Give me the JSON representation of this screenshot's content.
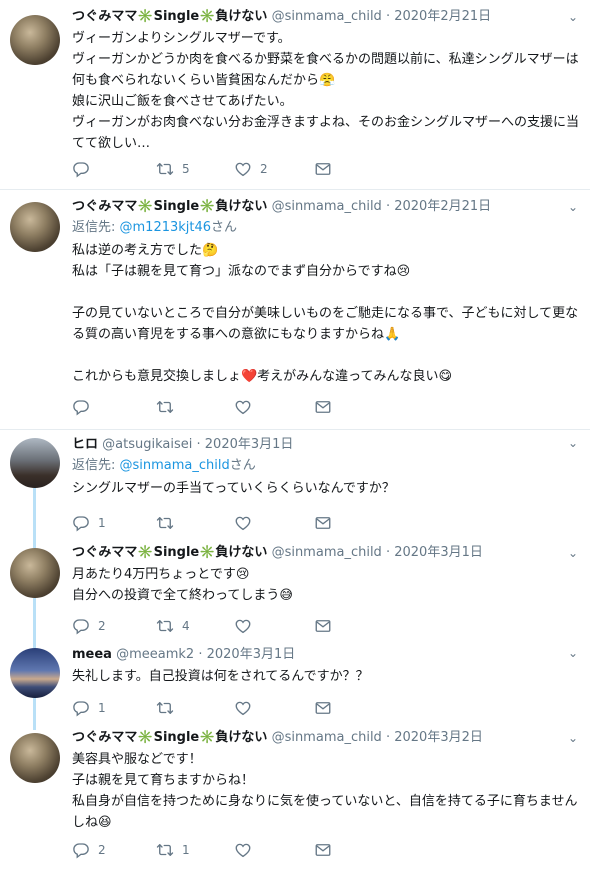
{
  "tweets": [
    {
      "name": "つぐみママ✳️Single✳️負けない",
      "handle": "@sinmama_child",
      "dot": "·",
      "date": "2020年2月21日",
      "text": "ヴィーガンよりシングルマザーです。\nヴィーガンかどうか肉を食べるか野菜を食べるかの問題以前に、私達シングルマザーは何も食べられないくらい皆貧困なんだから😤\n娘に沢山ご飯を食べさせてあげたい。\nヴィーガンがお肉食べない分お金浮きますよね、そのお金シングルマザーへの支援に当てて欲しい…",
      "reply_count": "",
      "retweet_count": "5",
      "like_count": "2"
    },
    {
      "name": "つぐみママ✳️Single✳️負けない",
      "handle": "@sinmama_child",
      "dot": "·",
      "date": "2020年2月21日",
      "reply_prefix": "返信先: ",
      "reply_link": "@m1213kjt46",
      "reply_suffix": "さん",
      "text": "私は逆の考え方でした🤔\n私は「子は親を見て育つ」派なのでまず自分からですね😢\n\n子の見ていないところで自分が美味しいものをご馳走になる事で、子どもに対して更なる質の高い育児をする事への意欲にもなりますからね🙏\n\nこれからも意見交換しましょ❤️考えがみんな違ってみんな良い😋",
      "reply_count": "",
      "retweet_count": "",
      "like_count": ""
    },
    {
      "name": "ヒロ",
      "handle": "@atsugikaisei",
      "dot": "·",
      "date": "2020年3月1日",
      "reply_prefix": "返信先: ",
      "reply_link": "@sinmama_child",
      "reply_suffix": "さん",
      "text": "シングルマザーの手当てっていくらくらいなんですか？",
      "reply_count": "1",
      "retweet_count": "",
      "like_count": ""
    },
    {
      "name": "つぐみママ✳️Single✳️負けない",
      "handle": "@sinmama_child",
      "dot": "·",
      "date": "2020年3月1日",
      "text": "月あたり4万円ちょっとです😢\n自分への投資で全て終わってしまう😅",
      "reply_count": "2",
      "retweet_count": "4",
      "like_count": ""
    },
    {
      "name": "meea",
      "handle": "@meeamk2",
      "dot": "·",
      "date": "2020年3月1日",
      "text": "失礼します。自己投資は何をされてるんですか？？",
      "reply_count": "1",
      "retweet_count": "",
      "like_count": ""
    },
    {
      "name": "つぐみママ✳️Single✳️負けない",
      "handle": "@sinmama_child",
      "dot": "·",
      "date": "2020年3月2日",
      "text": "美容具や服などです！\n子は親を見て育ちますからね！\n私自身が自信を持つために身なりに気を使っていないと、自信を持てる子に育ちませんしね😆",
      "reply_count": "2",
      "retweet_count": "1",
      "like_count": ""
    }
  ],
  "icons": {
    "reply": "reply-icon",
    "retweet": "retweet-icon",
    "like": "heart-icon",
    "dm": "envelope-icon",
    "more": "chevron-down-icon"
  },
  "colors": {
    "link": "#1b95e0",
    "muted": "#657786",
    "thread_line": "#b9e0f7",
    "separator": "#e6ecf0"
  }
}
